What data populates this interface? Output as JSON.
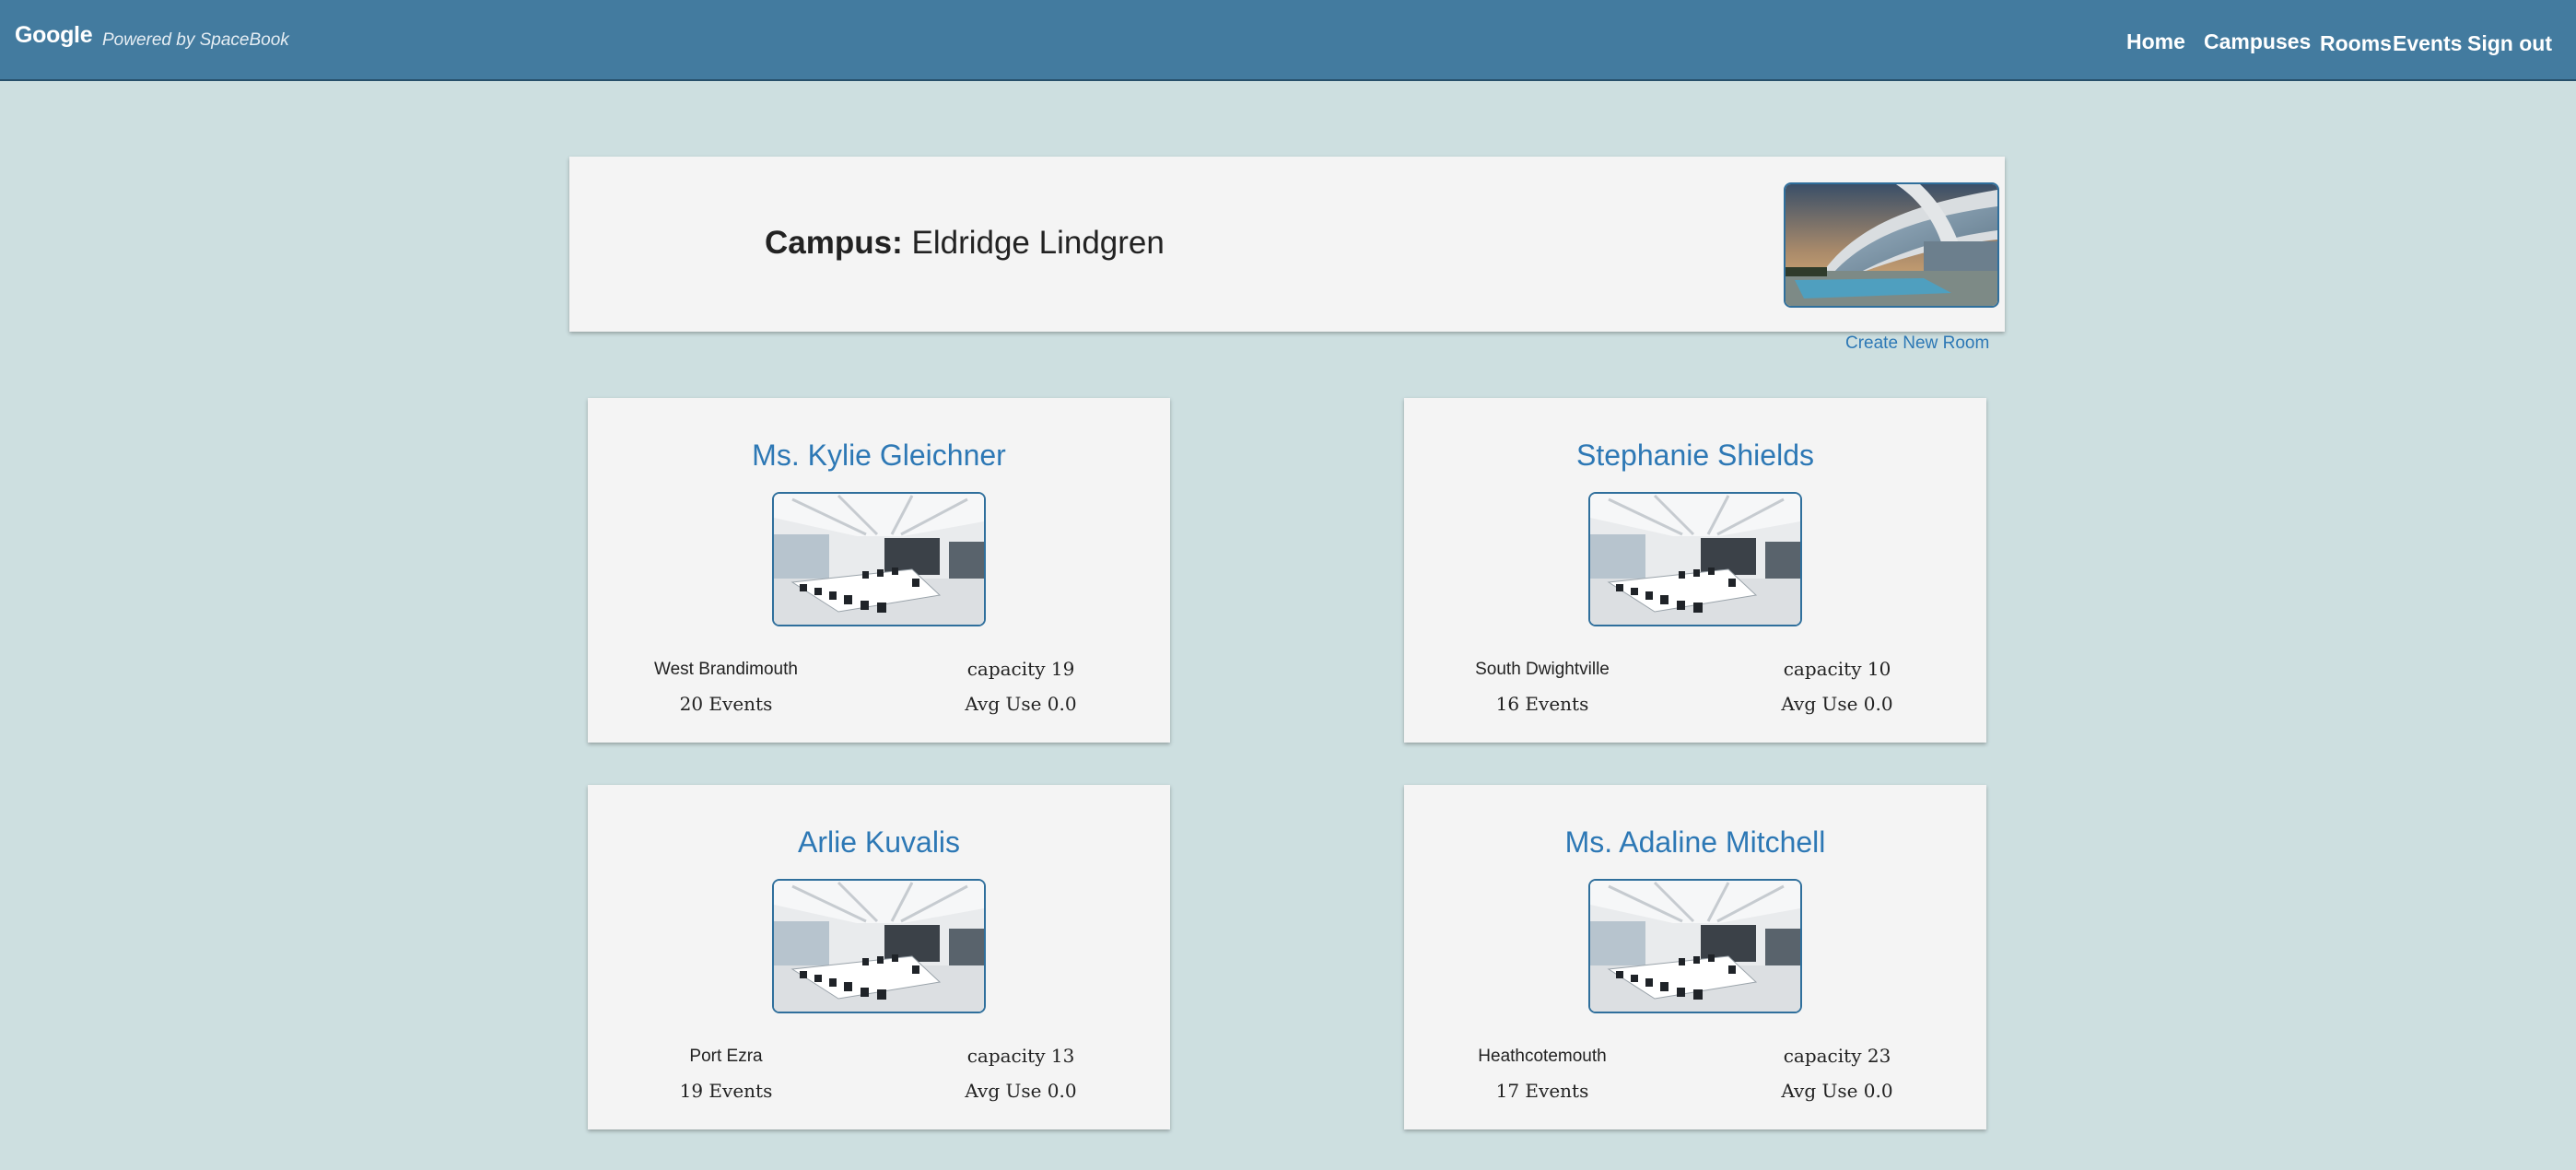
{
  "header": {
    "brand": "Google",
    "tagline": "Powered by SpaceBook",
    "nav": [
      "Home",
      "Campuses",
      "Rooms",
      "Events",
      "Sign out"
    ]
  },
  "campus": {
    "label": "Campus:",
    "name": "Eldridge Lindgren",
    "create_room": "Create New Room"
  },
  "rooms": [
    {
      "name": "Ms. Kylie Gleichner",
      "location": "West Brandimouth",
      "events": "20 Events",
      "capacity": "capacity 19",
      "avg_use": "Avg Use 0.0"
    },
    {
      "name": "Stephanie Shields",
      "location": "South Dwightville",
      "events": "16 Events",
      "capacity": "capacity 10",
      "avg_use": "Avg Use 0.0"
    },
    {
      "name": "Arlie Kuvalis",
      "location": "Port Ezra",
      "events": "19 Events",
      "capacity": "capacity 13",
      "avg_use": "Avg Use 0.0"
    },
    {
      "name": "Ms. Adaline Mitchell",
      "location": "Heathcotemouth",
      "events": "17 Events",
      "capacity": "capacity 23",
      "avg_use": "Avg Use 0.0"
    }
  ],
  "colors": {
    "topbar": "#437b9f",
    "background": "#cddfe0",
    "card": "#f4f4f4",
    "link": "#2d78b5"
  }
}
